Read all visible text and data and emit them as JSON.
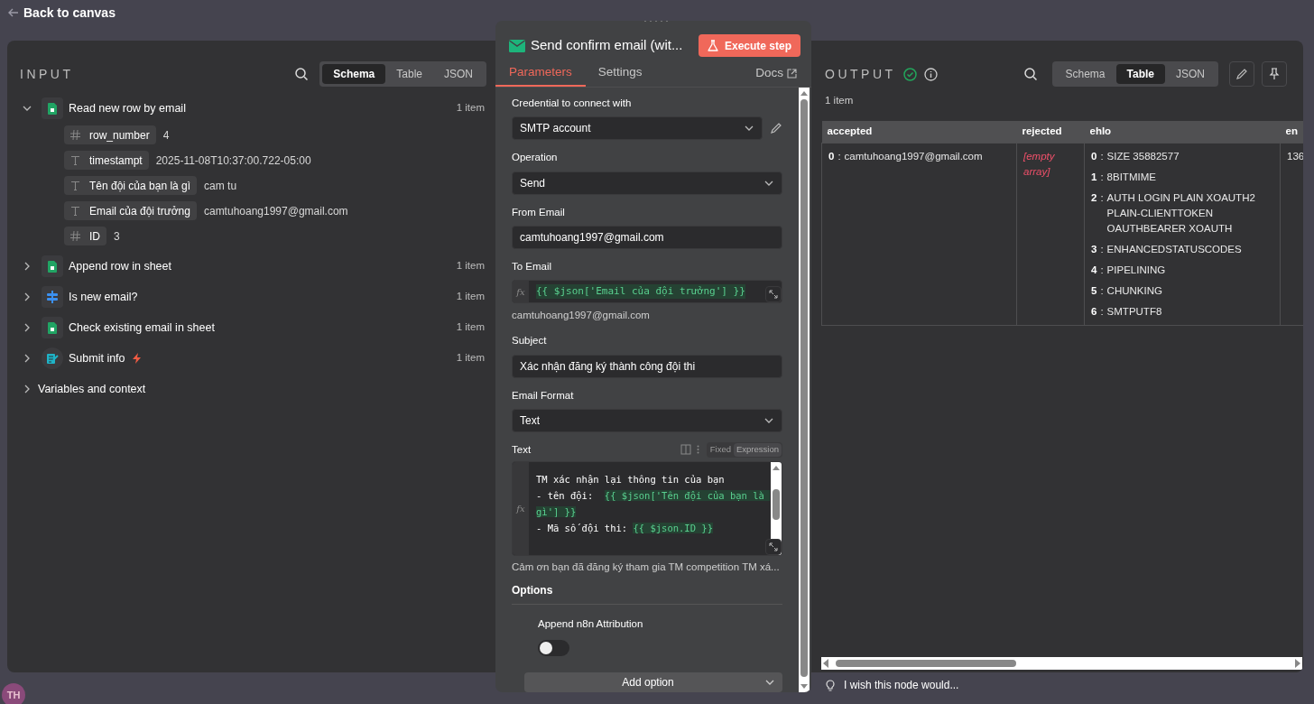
{
  "top_bar": {
    "back_label": "Back to canvas"
  },
  "avatar": {
    "initials": "TH"
  },
  "input": {
    "title": "INPUT",
    "view_tabs": [
      {
        "label": "Schema",
        "selected": true
      },
      {
        "label": "Table",
        "selected": false
      },
      {
        "label": "JSON",
        "selected": false
      }
    ],
    "nodes": [
      {
        "name": "Read new row by email",
        "kind": "sheet",
        "count": "1 item",
        "expanded": true,
        "trigger": false,
        "fields": [
          {
            "kind": "number",
            "key": "row_number",
            "value": "4"
          },
          {
            "kind": "text",
            "key": "timestampt",
            "value": "2025-11-08T10:37:00.722-05:00"
          },
          {
            "kind": "text",
            "key": "Tên đội của bạn là gì",
            "value": "cam tu"
          },
          {
            "kind": "text",
            "key": "Email của đội trưởng",
            "value": "camtuhoang1997@gmail.com"
          },
          {
            "kind": "number",
            "key": "ID",
            "value": "3"
          }
        ]
      },
      {
        "name": "Append row in sheet",
        "kind": "sheet",
        "count": "1 item",
        "expanded": false,
        "trigger": false
      },
      {
        "name": "Is new email?",
        "kind": "filter",
        "count": "1 item",
        "expanded": false,
        "trigger": false
      },
      {
        "name": "Check existing email in sheet",
        "kind": "sheet",
        "count": "1 item",
        "expanded": false,
        "trigger": false
      },
      {
        "name": "Submit info",
        "kind": "form",
        "count": "1 item",
        "expanded": false,
        "trigger": true
      }
    ],
    "variables": {
      "label": "Variables and context",
      "expanded": false
    }
  },
  "node": {
    "title": "Send confirm email (wit...",
    "execute_label": "Execute step",
    "tabs": [
      {
        "label": "Parameters",
        "selected": true
      },
      {
        "label": "Settings",
        "selected": false
      }
    ],
    "docs_label": "Docs",
    "params": [
      {
        "kind": "select",
        "label": "Credential to connect with",
        "value": "SMTP account",
        "editable": true
      },
      {
        "kind": "select",
        "label": "Operation",
        "value": "Send"
      },
      {
        "kind": "input",
        "label": "From Email",
        "value": "camtuhoang1997@gmail.com"
      },
      {
        "kind": "expression",
        "label": "To Email",
        "fx_label": "fx",
        "value": "{{ $json['Email của đội trưởng'] }}",
        "result": "camtuhoang1997@gmail.com"
      },
      {
        "kind": "input",
        "label": "Subject",
        "value": "Xác nhận đăng ký thành công đội thi"
      },
      {
        "kind": "select",
        "label": "Email Format",
        "value": "Text"
      },
      {
        "kind": "editor",
        "label": "Text",
        "fx_label": "fx",
        "modes": [
          {
            "label": "Fixed",
            "selected": false
          },
          {
            "label": "Expression",
            "selected": true
          }
        ],
        "lines": [
          [
            {
              "kind": "text",
              "text": "TM xác nhận lại thông tin của bạn"
            }
          ],
          [
            {
              "kind": "text",
              "text": "- tên đội:  "
            },
            {
              "kind": "expr",
              "text": "{{ $json['Tên đội của bạn là gì'] }}"
            }
          ],
          [
            {
              "kind": "text",
              "text": "- Mã số đội thi: "
            },
            {
              "kind": "expr",
              "text": "{{ $json.ID }}"
            }
          ]
        ],
        "result": "Cảm ơn bạn đã đăng ký tham gia TM competition TM xá..."
      }
    ],
    "options": {
      "title": "Options",
      "toggle_label": "Append n8n Attribution",
      "on": false,
      "add_label": "Add option"
    }
  },
  "output": {
    "title": "OUTPUT",
    "success": true,
    "view_tabs": [
      {
        "label": "Schema",
        "selected": false
      },
      {
        "label": "Table",
        "selected": true
      },
      {
        "label": "JSON",
        "selected": false
      }
    ],
    "count": "1 item",
    "table": {
      "columns": [
        "accepted",
        "rejected",
        "ehlo",
        "en"
      ],
      "rows": [
        [
          {
            "kind": "list",
            "separator": ":",
            "items": [
              {
                "index": "0",
                "value": "camtuhoang1997@gmail.com"
              }
            ]
          },
          {
            "kind": "empty",
            "text": "[empty array]"
          },
          {
            "kind": "list",
            "separator": ":",
            "items": [
              {
                "index": "0",
                "value": "SIZE 35882577"
              },
              {
                "index": "1",
                "value": "8BITMIME"
              },
              {
                "index": "2",
                "value": "AUTH LOGIN PLAIN XOAUTH2 PLAIN-CLIENTTOKEN OAUTHBEARER XOAUTH"
              },
              {
                "index": "3",
                "value": "ENHANCEDSTATUSCODES"
              },
              {
                "index": "4",
                "value": "PIPELINING"
              },
              {
                "index": "5",
                "value": "CHUNKING"
              },
              {
                "index": "6",
                "value": "SMTPUTF8"
              }
            ]
          },
          {
            "kind": "text",
            "text": "136"
          }
        ]
      ]
    }
  },
  "feedback": {
    "label": "I wish this node would..."
  }
}
